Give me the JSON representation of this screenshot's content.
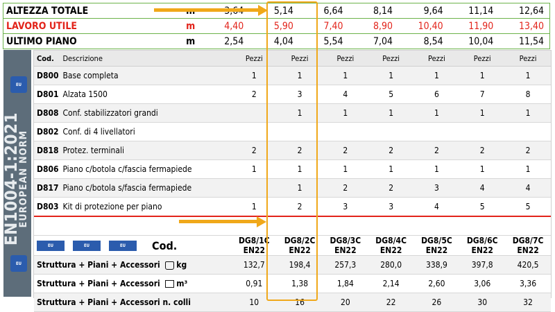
{
  "top_rows": [
    {
      "label": "ALTEZZA TOTALE",
      "unit": "m",
      "values": [
        "3,64",
        "5,14",
        "6,64",
        "8,14",
        "9,64",
        "11,14",
        "12,64"
      ],
      "color": "#000000"
    },
    {
      "label": "LAVORO UTILE",
      "unit": "m",
      "values": [
        "4,40",
        "5,90",
        "7,40",
        "8,90",
        "10,40",
        "11,90",
        "13,40"
      ],
      "color": "#e2231a"
    },
    {
      "label": "ULTIMO PIANO",
      "unit": "m",
      "values": [
        "2,54",
        "4,04",
        "5,54",
        "7,04",
        "8,54",
        "10,04",
        "11,54"
      ],
      "color": "#000000"
    }
  ],
  "sidebar": {
    "line1": "EN1004-1:2021",
    "line2": "EUROPEAN NORM",
    "badge": "EU"
  },
  "header": {
    "cod": "Cod.",
    "desc": "Descrizione",
    "pezzi": [
      "Pezzi",
      "Pezzi",
      "Pezzi",
      "Pezzi",
      "Pezzi",
      "Pezzi",
      "Pezzi"
    ]
  },
  "items": [
    {
      "code": "D800",
      "desc": "Base completa",
      "values": [
        "1",
        "1",
        "1",
        "1",
        "1",
        "1",
        "1"
      ]
    },
    {
      "code": "D801",
      "desc": "Alzata 1500",
      "values": [
        "2",
        "3",
        "4",
        "5",
        "6",
        "7",
        "8"
      ]
    },
    {
      "code": "D808",
      "desc": "Conf. stabilizzatori grandi",
      "values": [
        "",
        "1",
        "1",
        "1",
        "1",
        "1",
        "1"
      ]
    },
    {
      "code": "D802",
      "desc": "Conf. di 4 livellatori",
      "values": [
        "",
        "",
        "",
        "",
        "",
        "",
        ""
      ]
    },
    {
      "code": "D818",
      "desc": "Protez. terminali",
      "values": [
        "2",
        "2",
        "2",
        "2",
        "2",
        "2",
        "2"
      ]
    },
    {
      "code": "D806",
      "desc": "Piano c/botola c/fascia fermapiede",
      "values": [
        "1",
        "1",
        "1",
        "1",
        "1",
        "1",
        "1"
      ]
    },
    {
      "code": "D817",
      "desc": "Piano c/botola s/fascia fermapiede",
      "values": [
        "",
        "1",
        "2",
        "2",
        "3",
        "4",
        "4"
      ]
    },
    {
      "code": "D803",
      "desc": "Kit di protezione per piano",
      "values": [
        "1",
        "2",
        "3",
        "3",
        "4",
        "5",
        "5"
      ]
    }
  ],
  "codes_label": "Cod.",
  "codes": [
    "DG8/1C EN22",
    "DG8/2C EN22",
    "DG8/3C EN22",
    "DG8/4C EN22",
    "DG8/5C EN22",
    "DG8/6C EN22",
    "DG8/7C EN22"
  ],
  "bottom": [
    {
      "label": "Struttura + Piani + Accessori",
      "unit": "kg",
      "icon": "weight-icon",
      "values": [
        "132,7",
        "198,4",
        "257,3",
        "280,0",
        "338,9",
        "397,8",
        "420,5"
      ]
    },
    {
      "label": "Struttura + Piani + Accessori",
      "unit": "m³",
      "icon": "volume-icon",
      "values": [
        "0,91",
        "1,38",
        "1,84",
        "2,14",
        "2,60",
        "3,06",
        "3,36"
      ]
    },
    {
      "label": "Struttura + Piani + Accessori n. colli",
      "unit": "",
      "icon": "",
      "values": [
        "10",
        "16",
        "20",
        "22",
        "26",
        "30",
        "32"
      ]
    }
  ],
  "accent_color": "#f0a81a"
}
